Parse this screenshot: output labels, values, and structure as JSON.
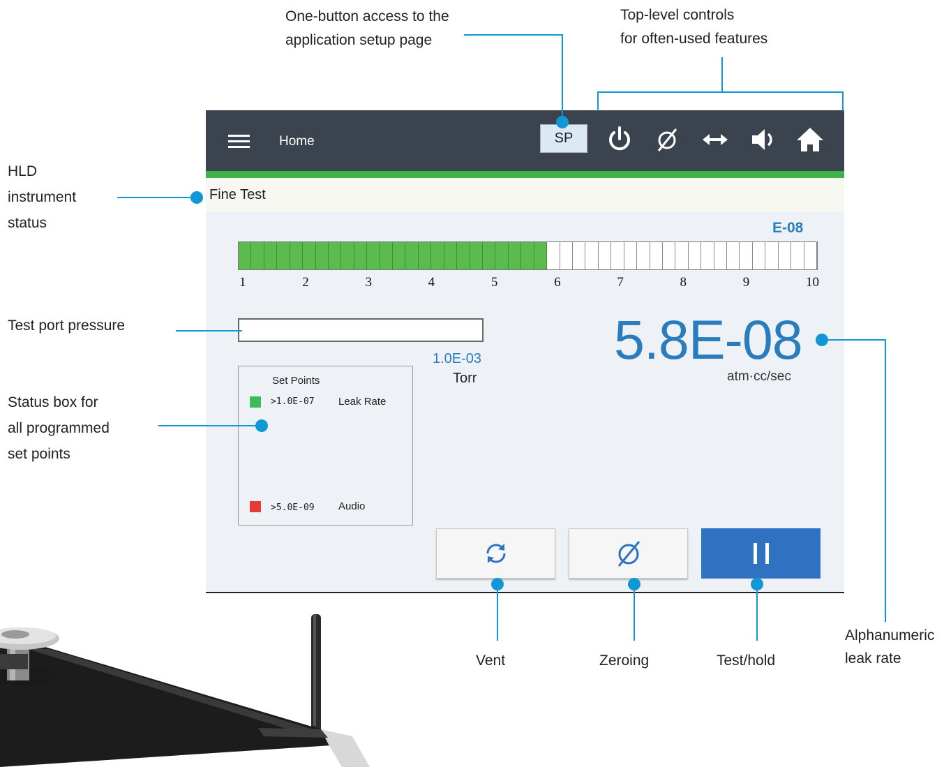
{
  "callouts": {
    "setup_page": [
      "One-button access to the",
      "application setup page"
    ],
    "top_controls": [
      "Top-level controls",
      "for often-used features"
    ],
    "hld_status": [
      "HLD",
      "instrument",
      "status"
    ],
    "port_pressure": "Test port pressure",
    "status_box": [
      "Status box for",
      "all programmed",
      "set points"
    ],
    "leak_rate": [
      "Alphanumeric",
      "leak rate"
    ],
    "vent": "Vent",
    "zeroing": "Zeroing",
    "test_hold": "Test/hold"
  },
  "screen": {
    "header": {
      "title": "Home",
      "sp_label": "SP",
      "icons": [
        "power-icon",
        "zero-icon",
        "arrows-horizontal-icon",
        "speaker-icon",
        "home-icon"
      ]
    },
    "status": "Fine Test",
    "bargraph": {
      "exponent_label": "E-08",
      "ticks": [
        "1",
        "2",
        "3",
        "4",
        "5",
        "6",
        "7",
        "8",
        "9",
        "10"
      ],
      "segments_total": 45,
      "segments_on": 24
    },
    "pressure": {
      "value": "1.0E-03",
      "unit": "Torr"
    },
    "leak_rate": {
      "value": "5.8E-08",
      "unit": "atm·cc/sec"
    },
    "set_points": {
      "title": "Set Points",
      "items": [
        {
          "color": "#3dbb5a",
          "threshold": ">1.0E-07",
          "label": "Leak Rate"
        },
        {
          "color": "#e53d34",
          "threshold": ">5.0E-09",
          "label": "Audio"
        }
      ]
    },
    "buttons": [
      "vent-icon",
      "zero-icon",
      "pause-icon"
    ],
    "colors": {
      "accent_blue": "#2a7dbd",
      "bar_green": "#5cbb4f",
      "header": "#3b434e",
      "hold_button": "#2f72c1",
      "callout": "#1196d6"
    }
  }
}
